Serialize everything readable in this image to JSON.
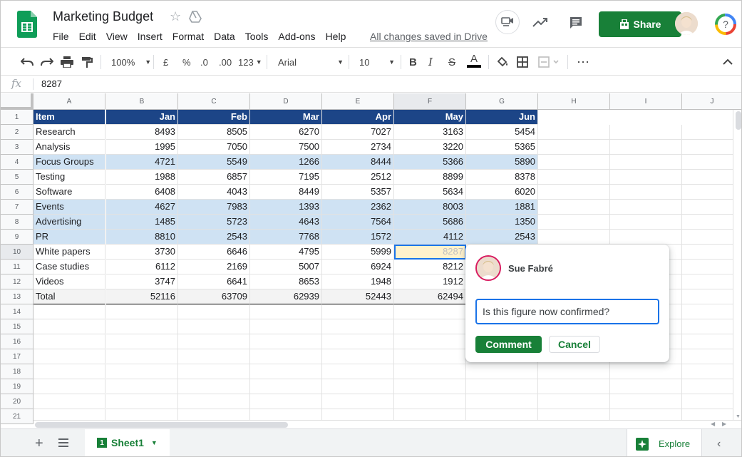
{
  "app": {
    "title": "Marketing Budget",
    "menu": [
      "File",
      "Edit",
      "View",
      "Insert",
      "Format",
      "Data",
      "Tools",
      "Add-ons",
      "Help"
    ],
    "saved_status": "All changes saved in Drive",
    "share_label": "Share"
  },
  "toolbar": {
    "zoom": "100%",
    "currency": "£",
    "percent": "%",
    "dec_decrease": ".0",
    "dec_increase": ".00",
    "more_formats": "123",
    "font": "Arial",
    "font_size": "10",
    "bold": "B",
    "italic": "I",
    "strike": "S",
    "text_color_glyph": "A"
  },
  "formula_bar": {
    "fx": "fx",
    "value": "8287"
  },
  "grid": {
    "columns": [
      "A",
      "B",
      "C",
      "D",
      "E",
      "F",
      "G",
      "H",
      "I",
      "J"
    ],
    "row_numbers": [
      "1",
      "2",
      "3",
      "4",
      "5",
      "6",
      "7",
      "8",
      "9",
      "10",
      "11",
      "12",
      "13",
      "14",
      "15",
      "16",
      "17",
      "18",
      "19",
      "20",
      "21"
    ],
    "header": [
      "Item",
      "Jan",
      "Feb",
      "Mar",
      "Apr",
      "May",
      "Jun"
    ],
    "rows": [
      [
        "Research",
        "8493",
        "8505",
        "6270",
        "7027",
        "3163",
        "5454"
      ],
      [
        "Analysis",
        "1995",
        "7050",
        "7500",
        "2734",
        "3220",
        "5365"
      ],
      [
        "Focus Groups",
        "4721",
        "5549",
        "1266",
        "8444",
        "5366",
        "5890"
      ],
      [
        "Testing",
        "1988",
        "6857",
        "7195",
        "2512",
        "8899",
        "8378"
      ],
      [
        "Software",
        "6408",
        "4043",
        "8449",
        "5357",
        "5634",
        "6020"
      ],
      [
        "Events",
        "4627",
        "7983",
        "1393",
        "2362",
        "8003",
        "1881"
      ],
      [
        "Advertising",
        "1485",
        "5723",
        "4643",
        "7564",
        "5686",
        "1350"
      ],
      [
        "PR",
        "8810",
        "2543",
        "7768",
        "1572",
        "4112",
        "2543"
      ],
      [
        "White papers",
        "3730",
        "6646",
        "4795",
        "5999",
        "8287",
        ""
      ],
      [
        "Case studies",
        "6112",
        "2169",
        "5007",
        "6924",
        "8212",
        ""
      ],
      [
        "Videos",
        "3747",
        "6641",
        "8653",
        "1948",
        "1912",
        ""
      ],
      [
        "Total",
        "52116",
        "63709",
        "62939",
        "52443",
        "62494",
        ""
      ]
    ]
  },
  "comment": {
    "author": "Sue Fabré",
    "input_value": "Is this figure now confirmed?",
    "comment_button": "Comment",
    "cancel_button": "Cancel"
  },
  "sheets": {
    "active_tab": "Sheet1",
    "tab_number": "1",
    "explore_label": "Explore"
  },
  "colors": {
    "header_fill": "#1c4587",
    "band_fill": "#cfe2f3",
    "selected_fill": "#fff2cc",
    "brand_green": "#188038",
    "selection_blue": "#1a73e8"
  }
}
